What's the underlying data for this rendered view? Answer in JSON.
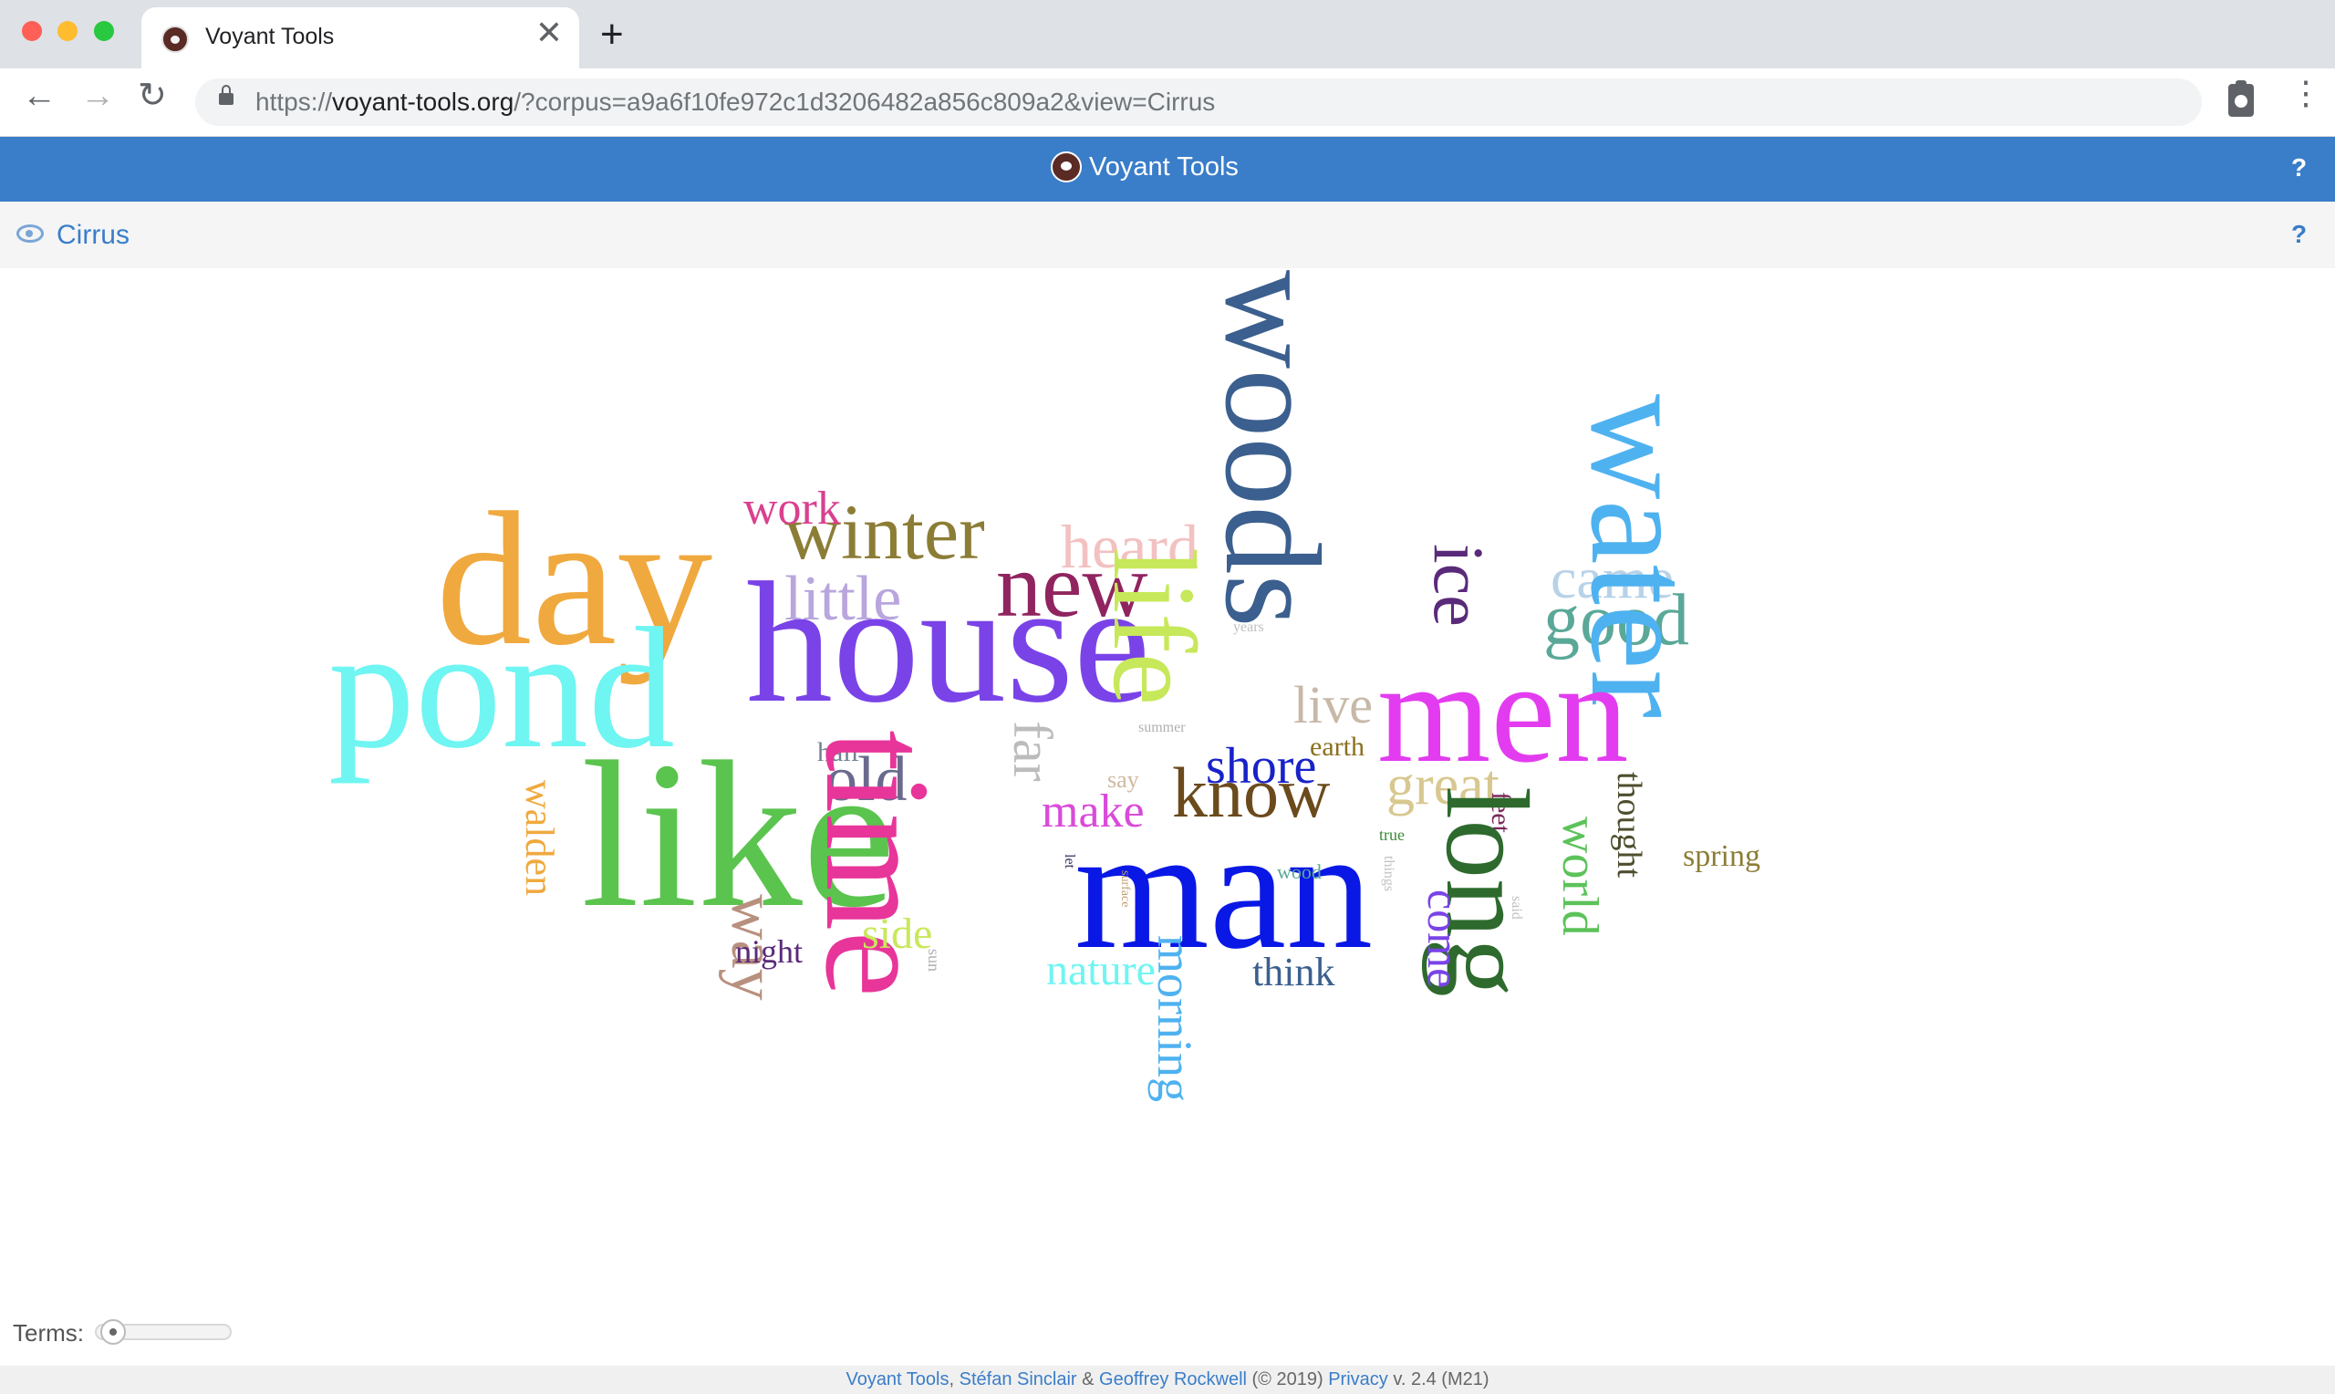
{
  "browser": {
    "tab_title": "Voyant Tools",
    "tab_close": "✕",
    "new_tab": "+",
    "url_scheme": "https://",
    "url_host": "voyant-tools.org",
    "url_rest": "/?corpus=a9a6f10fe972c1d3206482a856c809a2&view=Cirrus",
    "back": "←",
    "forward": "→",
    "reload": "↻",
    "menu": "⋮"
  },
  "app": {
    "header_title": "Voyant Tools",
    "help": "?"
  },
  "panel": {
    "title": "Cirrus",
    "help": "?"
  },
  "cirrus": {
    "words": [
      {
        "text": "day",
        "color": "#f0a93e"
      },
      {
        "text": "pond",
        "color": "#6ff5f2"
      },
      {
        "text": "house",
        "color": "#7a43e8"
      },
      {
        "text": "winter",
        "color": "#8c7d36"
      },
      {
        "text": "work",
        "color": "#d9408f"
      },
      {
        "text": "little",
        "color": "#b8a6dd"
      },
      {
        "text": "new",
        "color": "#90245f"
      },
      {
        "text": "heard",
        "color": "#f3c1c1"
      },
      {
        "text": "life",
        "color": "#c7e85a"
      },
      {
        "text": "woods",
        "color": "#3b5f8e"
      },
      {
        "text": "ice",
        "color": "#5a2a7a"
      },
      {
        "text": "came",
        "color": "#b8d2e8"
      },
      {
        "text": "good",
        "color": "#5aa898"
      },
      {
        "text": "water",
        "color": "#4fb2f0"
      },
      {
        "text": "men",
        "color": "#e33cf0"
      },
      {
        "text": "like",
        "color": "#5bc44e"
      },
      {
        "text": "half",
        "color": "#708090"
      },
      {
        "text": "old",
        "color": "#6a6a8e"
      },
      {
        "text": "time",
        "color": "#e8359a"
      },
      {
        "text": "far",
        "color": "#bcbcbc"
      },
      {
        "text": "say",
        "color": "#d0b8a0"
      },
      {
        "text": "summer",
        "color": "#b0b0b0"
      },
      {
        "text": "years",
        "color": "#c0c0c0"
      },
      {
        "text": "live",
        "color": "#c8b8a8"
      },
      {
        "text": "earth",
        "color": "#8a6f1f"
      },
      {
        "text": "shore",
        "color": "#1822c8"
      },
      {
        "text": "know",
        "color": "#6b4a1c"
      },
      {
        "text": "great",
        "color": "#d8c890"
      },
      {
        "text": "feet",
        "color": "#7a2a5a"
      },
      {
        "text": "long",
        "color": "#2e6a2e"
      },
      {
        "text": "thought",
        "color": "#4e4e2e"
      },
      {
        "text": "world",
        "color": "#5cc25a"
      },
      {
        "text": "spring",
        "color": "#8c7d36"
      },
      {
        "text": "make",
        "color": "#d94bd9"
      },
      {
        "text": "man",
        "color": "#0a18e6"
      },
      {
        "text": "walden",
        "color": "#f0a93e"
      },
      {
        "text": "way",
        "color": "#b8907e"
      },
      {
        "text": "side",
        "color": "#c8e85a"
      },
      {
        "text": "night",
        "color": "#5a2a7a"
      },
      {
        "text": "sun",
        "color": "#b0b0b0"
      },
      {
        "text": "nature",
        "color": "#6ff5f2"
      },
      {
        "text": "morning",
        "color": "#4fb2f0"
      },
      {
        "text": "think",
        "color": "#3b5f8e"
      },
      {
        "text": "come",
        "color": "#7a43e8"
      },
      {
        "text": "let",
        "color": "#303060"
      },
      {
        "text": "surface",
        "color": "#c0a070"
      },
      {
        "text": "true",
        "color": "#3a8a3a"
      },
      {
        "text": "wood",
        "color": "#5aa898"
      },
      {
        "text": "things",
        "color": "#c0c0c0"
      },
      {
        "text": "said",
        "color": "#c0c0c0"
      }
    ]
  },
  "controls": {
    "terms_label": "Terms:"
  },
  "footer": {
    "voyant": "Voyant Tools",
    "sep1": ", ",
    "sinclair": "Stéfan Sinclair",
    "amp": " & ",
    "rockwell": "Geoffrey Rockwell",
    "copyright": " (© 2019) ",
    "privacy": "Privacy",
    "version": " v. 2.4 (M21)"
  }
}
